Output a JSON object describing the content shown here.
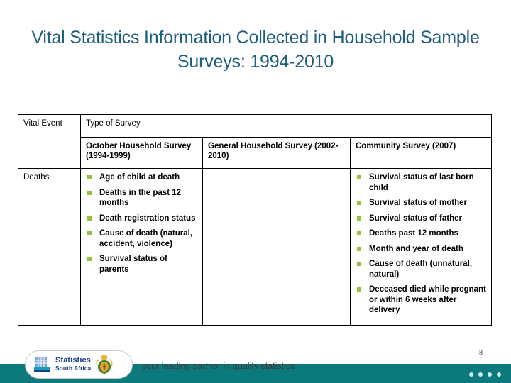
{
  "slide": {
    "title": "Vital Statistics Information Collected in Household Sample Surveys: 1994-2010",
    "page_number": "8",
    "title_color": "#1F5F7E",
    "bullet_color": "#97C13C",
    "footer_color": "#0C7A7D"
  },
  "table": {
    "header_row_1": {
      "vital_event": "Vital Event",
      "type_of_survey": "Type of Survey"
    },
    "header_row_2": {
      "october_household_survey": "October Household Survey (1994-1999)",
      "general_household_survey": "General Household Survey (2002-2010)",
      "community_survey": "Community Survey (2007)"
    },
    "rows": [
      {
        "vital_event": "Deaths",
        "october_household_survey": [
          "Age of child at death",
          "Deaths in the past 12 months",
          "Death registration status",
          "Cause of death (natural, accident, violence)",
          "Survival status of parents"
        ],
        "general_household_survey": [],
        "community_survey": [
          "Survival status of last born child",
          "Survival status of mother",
          "Survival status of father",
          "Deaths past 12 months",
          "Month and year of death",
          "Cause of death (unnatural, natural)",
          "Deceased died while pregnant or within 6 weeks after delivery"
        ]
      }
    ]
  },
  "footer": {
    "logo_line_1": "Statistics",
    "logo_line_2": "South Africa",
    "tagline": "your leading partner in quality statistics",
    "dots_count": 4
  }
}
